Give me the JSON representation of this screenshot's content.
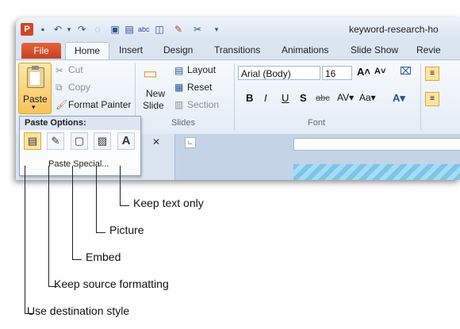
{
  "window": {
    "title": "keyword-research-ho",
    "app_icon": "powerpoint-logo"
  },
  "tabs": [
    "File",
    "Home",
    "Insert",
    "Design",
    "Transitions",
    "Animations",
    "Slide Show",
    "Revie"
  ],
  "clipboard": {
    "paste_label": "Paste",
    "cut_label": "Cut",
    "copy_label": "Copy",
    "format_painter_label": "Format Painter"
  },
  "slides": {
    "new_slide_line1": "New",
    "new_slide_line2": "Slide",
    "layout_label": "Layout",
    "reset_label": "Reset",
    "section_label": "Section",
    "group_label": "Slides"
  },
  "font": {
    "name": "Arial (Body)",
    "size": "16",
    "group_label": "Font"
  },
  "paste_menu": {
    "header": "Paste Options:",
    "special": "Paste Special...",
    "options": [
      "use-destination-style",
      "keep-source-formatting",
      "embed",
      "picture",
      "keep-text-only"
    ]
  },
  "callouts": {
    "keep_text_only": "Keep text only",
    "picture": "Picture",
    "embed": "Embed",
    "keep_source": "Keep source formatting",
    "use_destination": "Use destination style"
  },
  "colors": {
    "file_tab": "#d24726",
    "paste_highlight": "#f7c35b",
    "ribbon_bg": "#e4ecf6"
  }
}
